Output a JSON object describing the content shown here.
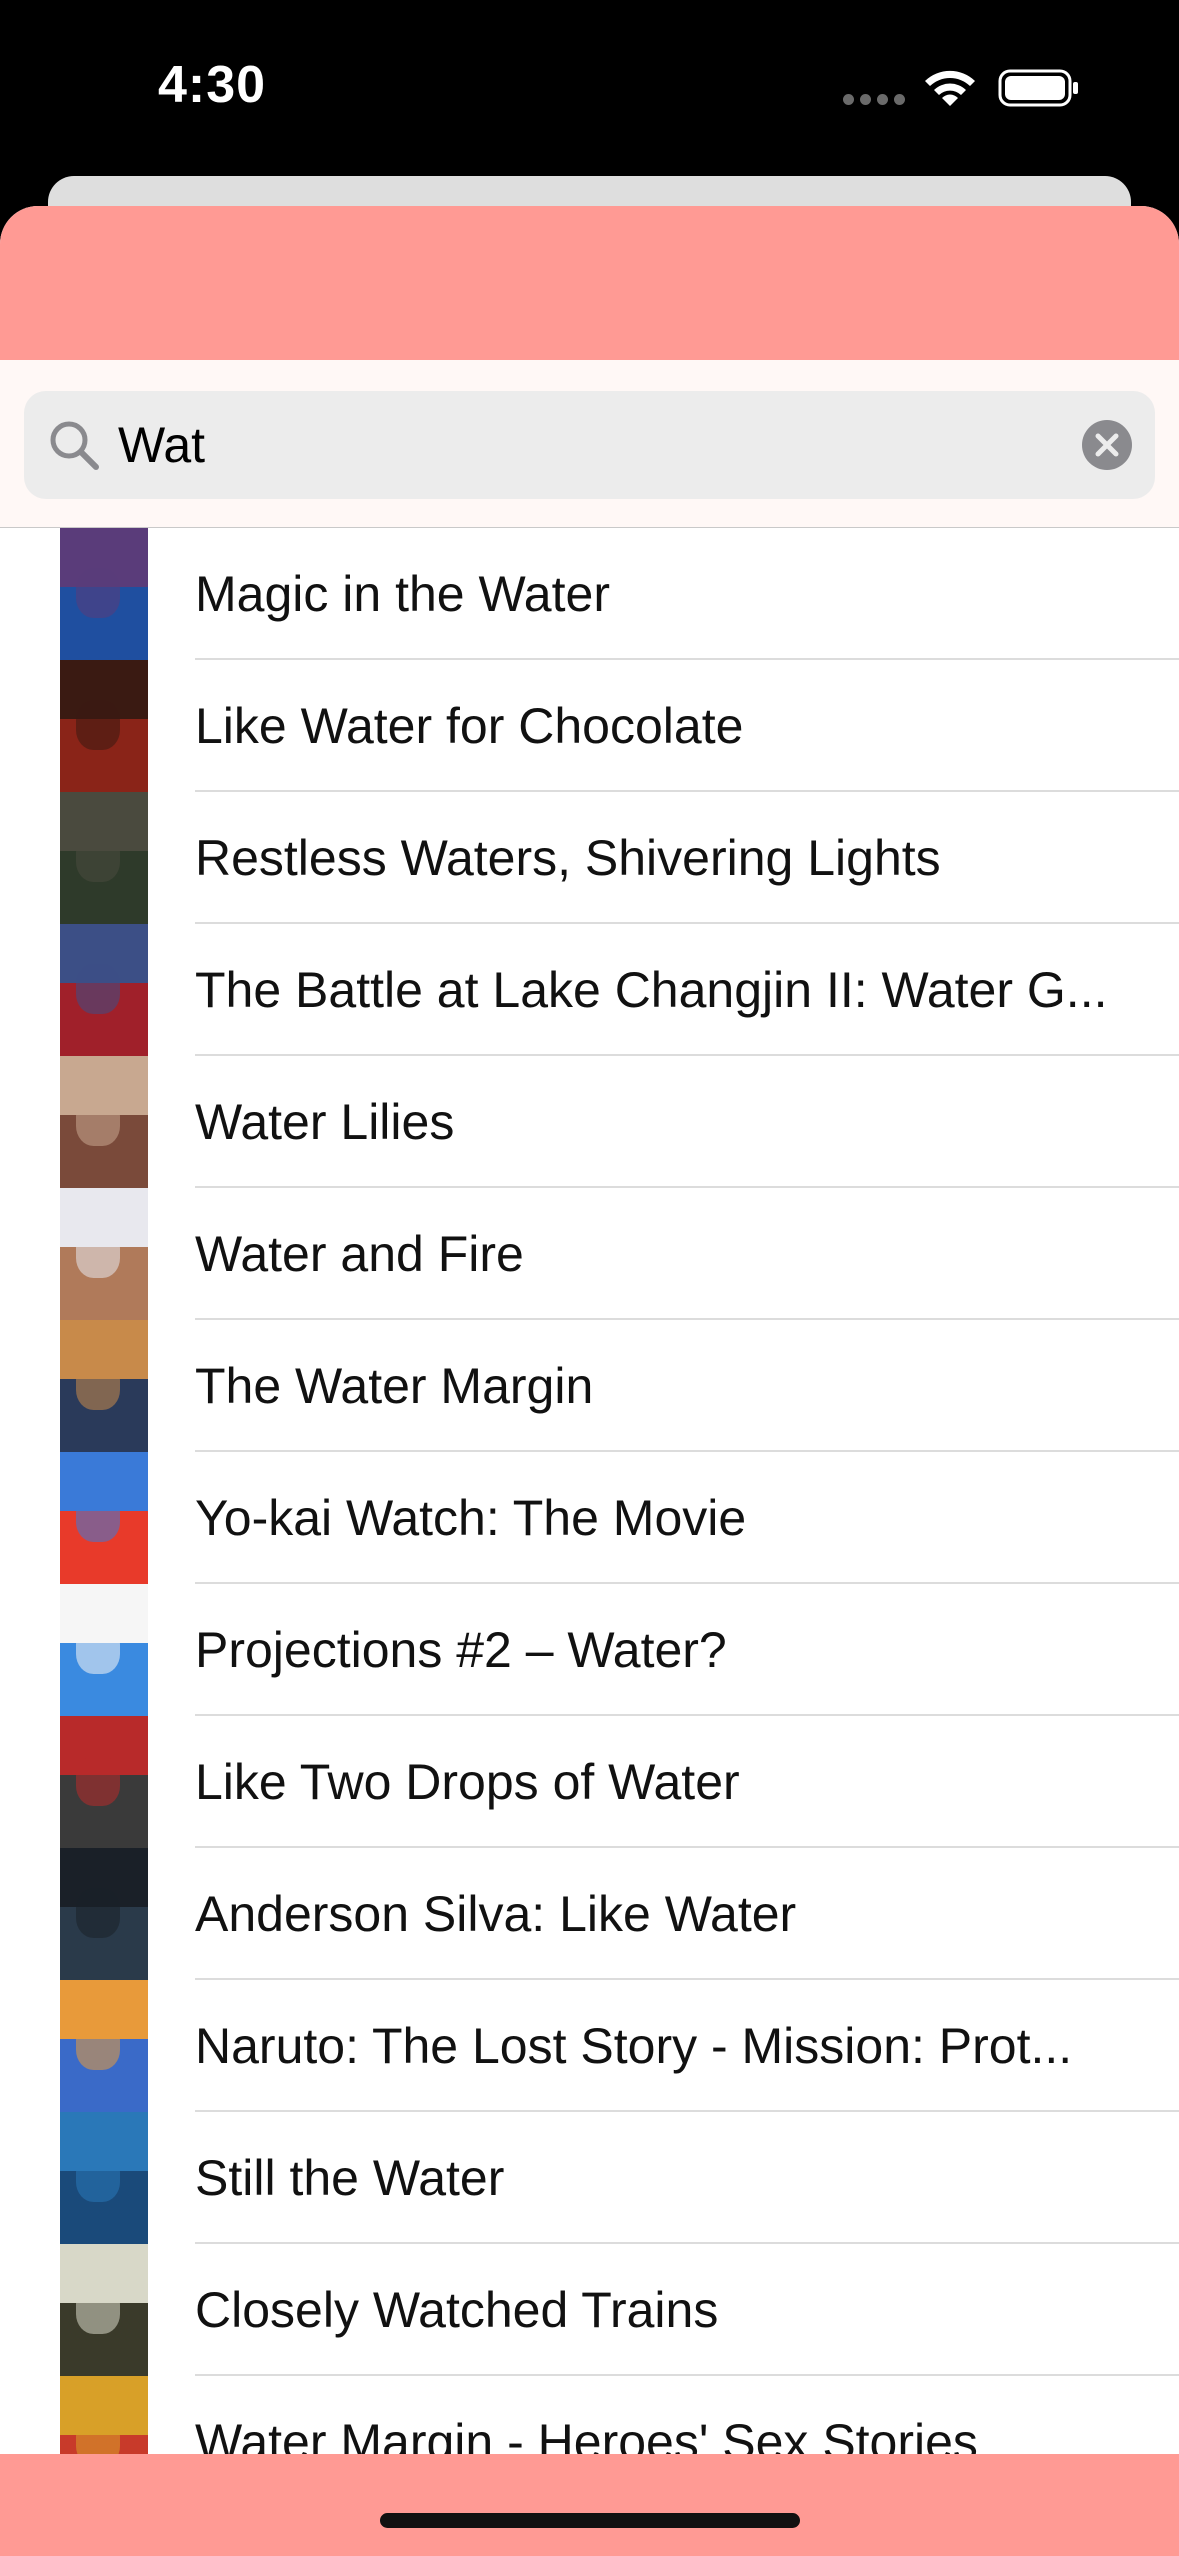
{
  "status_bar": {
    "time": "4:30"
  },
  "search": {
    "value": "Wat",
    "icon": "search-icon",
    "clear_icon": "clear-icon"
  },
  "results": [
    {
      "title": "Magic in the Water",
      "poster_colors": [
        "#5a3c7a",
        "#1f4fa0"
      ]
    },
    {
      "title": "Like Water for Chocolate",
      "poster_colors": [
        "#3a1a12",
        "#8a2418"
      ]
    },
    {
      "title": "Restless Waters, Shivering Lights",
      "poster_colors": [
        "#4a4a3e",
        "#2e3a2a"
      ]
    },
    {
      "title": "The Battle at Lake Changjin II: Water G...",
      "poster_colors": [
        "#3c4f86",
        "#a0202a"
      ]
    },
    {
      "title": "Water Lilies",
      "poster_colors": [
        "#c8a890",
        "#7a4a3a"
      ]
    },
    {
      "title": "Water and Fire",
      "poster_colors": [
        "#e8e8ee",
        "#b07a5a"
      ]
    },
    {
      "title": "The Water Margin",
      "poster_colors": [
        "#c88a4a",
        "#2a3a5a"
      ]
    },
    {
      "title": "Yo-kai Watch: The Movie",
      "poster_colors": [
        "#3a7ad8",
        "#e83a2a"
      ]
    },
    {
      "title": "Projections #2 – Water?",
      "poster_colors": [
        "#f6f6f6",
        "#3a8ae0"
      ]
    },
    {
      "title": "Like Two Drops of Water",
      "poster_colors": [
        "#b82a2a",
        "#3a3a3a"
      ]
    },
    {
      "title": "Anderson Silva: Like Water",
      "poster_colors": [
        "#1a2028",
        "#2a3a4a"
      ]
    },
    {
      "title": "Naruto: The Lost Story - Mission: Prot...",
      "poster_colors": [
        "#e89a3a",
        "#3a6ac8"
      ]
    },
    {
      "title": "Still the Water",
      "poster_colors": [
        "#2a78b8",
        "#1a4a7a"
      ]
    },
    {
      "title": "Closely Watched Trains",
      "poster_colors": [
        "#d8d8c8",
        "#3a3a2a"
      ]
    },
    {
      "title": "Water Margin - Heroes' Sex Stories",
      "poster_colors": [
        "#d8a028",
        "#c83a2a"
      ]
    }
  ],
  "colors": {
    "accent": "#ff9a94",
    "search_background": "#fff8f6",
    "search_field": "#ececec"
  }
}
